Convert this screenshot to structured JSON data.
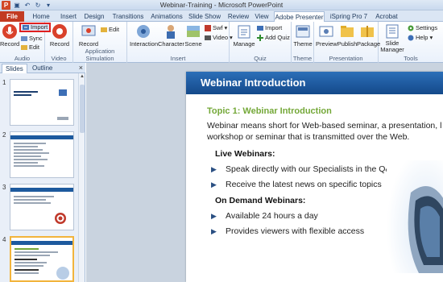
{
  "window": {
    "title": "Webinar-Training - Microsoft PowerPoint"
  },
  "qat": {
    "app_letter": "P"
  },
  "tabs": [
    "File",
    "Home",
    "Insert",
    "Design",
    "Transitions",
    "Animations",
    "Slide Show",
    "Review",
    "View",
    "Adobe Presenter",
    "iSpring Pro 7",
    "Acrobat"
  ],
  "ribbon": {
    "groups": {
      "audio": "Audio",
      "video": "Video",
      "app_sim": "Application Simulation",
      "insert": "Insert",
      "quiz": "Quiz",
      "theme": "Theme",
      "presentation": "Presentation",
      "tools": "Tools"
    },
    "buttons": {
      "record_audio": "Record",
      "import": "Import",
      "sync": "Sync",
      "edit_audio": "Edit",
      "record_video": "Record",
      "record_sim": "Record",
      "edit_sim": "Edit",
      "interaction": "Interaction",
      "character": "Character",
      "scene": "Scene",
      "swf": "Swf",
      "video": "Video",
      "manage": "Manage",
      "import_quiz": "Import",
      "add_quiz": "Add Quiz",
      "theme": "Theme",
      "preview": "Preview",
      "publish": "Publish",
      "package": "Package",
      "slide_manager": "Slide Manager",
      "settings": "Settings",
      "help": "Help"
    }
  },
  "left_pane": {
    "tabs": [
      "Slides",
      "Outline"
    ],
    "close": "×",
    "slide_numbers": [
      "1",
      "2",
      "3",
      "4"
    ]
  },
  "slide": {
    "title": "Webinar Introduction",
    "topic": "Topic 1: Webinar Introduction",
    "para_line1": "Webinar means short for Web-based seminar, a presentation, l",
    "para_line2": "workshop or seminar that is transmitted over the Web.",
    "live_heading": "Live Webinars:",
    "live_bullets": [
      "Speak directly with our Specialists in the Q&A",
      "Receive the latest news on specific topics"
    ],
    "demand_heading": "On Demand Webinars:",
    "demand_bullets": [
      "Available 24 hours a day",
      "Provides viewers with flexible access"
    ]
  },
  "colors": {
    "file_tab": "#c23b22",
    "slide_header": "#1d5a9e",
    "topic_green": "#74a838",
    "highlight": "#e02020"
  }
}
